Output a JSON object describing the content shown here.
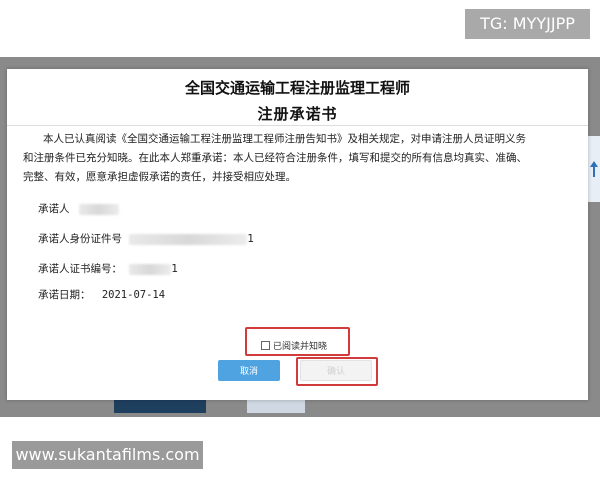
{
  "watermarks": {
    "top": "TG: MYYJJPP",
    "bottom": "www.sukantafilms.com"
  },
  "modal": {
    "title_line1": "全国交通运输工程注册监理工程师",
    "title_line2": "注册承诺书",
    "body_line1": "本人已认真阅读《全国交通运输工程注册监理工程师注册告知书》及相关规定，对申请注册人员证明义务",
    "body_line2": "和注册条件已充分知晓。在此本人郑重承诺：本人已经符合注册条件，填写和提交的所有信息均真实、准确、",
    "body_line3": "完整、有效，愿意承担虚假承诺的责任，并接受相应处理。",
    "fields": {
      "promisor_label": "承诺人",
      "id_label": "承诺人身份证件号",
      "id_suffix": "1",
      "cert_label": "承诺人证书编号：",
      "cert_suffix": "1",
      "date_label": "承诺日期：",
      "date_value": "2021-07-14"
    },
    "checkbox_label": "已阅读并知晓",
    "cancel_label": "取消",
    "submit_label": "确认"
  },
  "colors": {
    "highlight": "#d23b3b",
    "cancel_button": "#4fa3e0"
  }
}
